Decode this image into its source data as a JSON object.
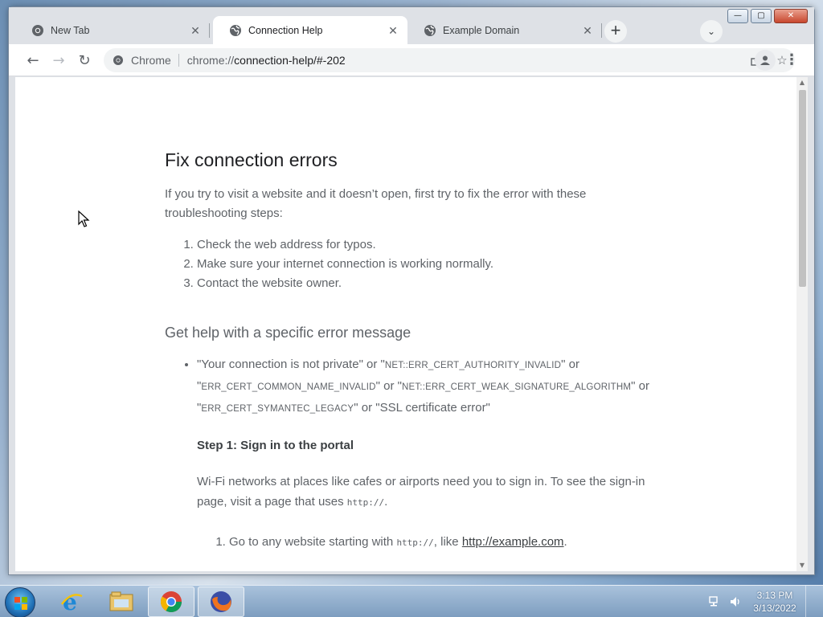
{
  "browser": {
    "tabs": [
      {
        "title": "New Tab",
        "favicon": "chrome-icon",
        "active": false
      },
      {
        "title": "Connection Help",
        "favicon": "globe-icon",
        "active": true
      },
      {
        "title": "Example Domain",
        "favicon": "globe-icon",
        "active": false
      }
    ],
    "new_tab_label": "+",
    "window_buttons": {
      "minimize": "—",
      "maximize": "▢",
      "close": "✕"
    },
    "omnibox": {
      "chip": "Chrome",
      "url_scheme": "chrome://",
      "url_rest": "connection-help/#-202"
    }
  },
  "page": {
    "title": "Fix connection errors",
    "intro": "If you try to visit a website and it doesn’t open, first try to fix the error with these troubleshooting steps:",
    "steps": [
      "Check the web address for typos.",
      "Make sure your internet connection is working normally.",
      "Contact the website owner."
    ],
    "subheading": "Get help with a specific error message",
    "bullet": {
      "q1_open": "\"Your connection is not private\" or \"",
      "code1": "NET::ERR_CERT_AUTHORITY_INVALID",
      "q1_close": "\" or",
      "q2_open": "\"",
      "code2": "ERR_CERT_COMMON_NAME_INVALID",
      "q2_mid": "\" or \"",
      "code3": "NET::ERR_CERT_WEAK_SIGNATURE_ALGORITHM",
      "q2_close": "\" or",
      "q3_open": "\"",
      "code4": "ERR_CERT_SYMANTEC_LEGACY",
      "q3_close": "\" or \"SSL certificate error\""
    },
    "step1_title": "Step 1: Sign in to the portal",
    "step1_text_a": "Wi-Fi networks at places like cafes or airports need you to sign in. To see the sign-in page, visit a page that uses ",
    "step1_code": "http://",
    "step1_text_b": ".",
    "sub_step_a": "Go to any website starting with ",
    "sub_step_code": "http://",
    "sub_step_b": ", like ",
    "sub_step_link": "http://example.com",
    "sub_step_c": "."
  },
  "taskbar": {
    "apps": [
      "internet-explorer-icon",
      "file-explorer-icon",
      "chrome-icon",
      "firefox-icon"
    ],
    "clock_time": "3:13 PM",
    "clock_date": "3/13/2022"
  },
  "colors": {
    "accent": "#1a73e8",
    "tabstrip": "#dee1e6",
    "text_primary": "#202124",
    "text_secondary": "#5f6368"
  }
}
